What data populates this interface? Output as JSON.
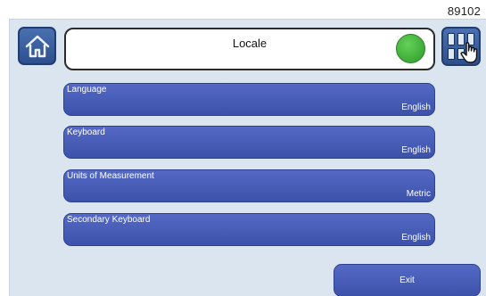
{
  "figure_id": "89102",
  "header": {
    "title": "Locale",
    "status_color": "#4cbf44"
  },
  "icons": {
    "home": "home-icon",
    "menu": "grid-menu-icon",
    "pointer": "hand-pointer-icon"
  },
  "settings": [
    {
      "label": "Language",
      "value": "English"
    },
    {
      "label": "Keyboard",
      "value": "English"
    },
    {
      "label": "Units of Measurement",
      "value": "Metric"
    },
    {
      "label": "Secondary Keyboard",
      "value": "English"
    }
  ],
  "footer": {
    "exit_label": "Exit"
  },
  "colors": {
    "background": "#dbe5f0",
    "button": "#4a5fbb",
    "header_button": "#3d63a6"
  }
}
